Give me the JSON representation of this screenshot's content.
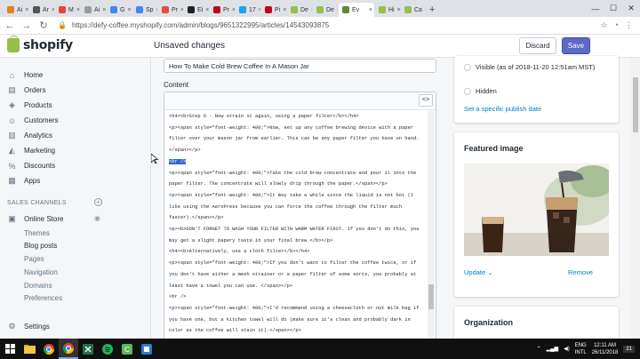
{
  "browser": {
    "tabs": [
      {
        "label": "Ai",
        "color": "#e67e22"
      },
      {
        "label": "Ar",
        "color": "#555555"
      },
      {
        "label": "M",
        "color": "#ea4335"
      },
      {
        "label": "Ai",
        "color": "#9b9b9b"
      },
      {
        "label": "G",
        "color": "#4285f4"
      },
      {
        "label": "Sp",
        "color": "#4285f4"
      },
      {
        "label": "Pr",
        "color": "#e74c3c"
      },
      {
        "label": "Ei",
        "color": "#222222"
      },
      {
        "label": "Pr",
        "color": "#bd081c"
      },
      {
        "label": "17",
        "color": "#1da1f2"
      },
      {
        "label": "Pi",
        "color": "#bd081c"
      },
      {
        "label": "De",
        "color": "#96bf48"
      },
      {
        "label": "De",
        "color": "#96bf48"
      },
      {
        "label": "Ev",
        "color": "#5b8a3c"
      },
      {
        "label": "Hi",
        "color": "#96bf48"
      },
      {
        "label": "Ca",
        "color": "#96bf48"
      }
    ],
    "active_tab_label": "Ev",
    "new_tab": "+",
    "url": "https://defy-coffee.myshopify.com/admin/blogs/9651322995/articles/14543093875",
    "nav_back": "←",
    "nav_forward": "→",
    "nav_reload": "↻"
  },
  "header": {
    "logo_text": "shopify",
    "status": "Unsaved changes",
    "discard_label": "Discard",
    "save_label": "Save"
  },
  "sidebar": {
    "items": [
      {
        "label": "Home",
        "icon": "home-icon",
        "glyph": "⌂"
      },
      {
        "label": "Orders",
        "icon": "orders-icon",
        "glyph": "▤"
      },
      {
        "label": "Products",
        "icon": "products-icon",
        "glyph": "◈"
      },
      {
        "label": "Customers",
        "icon": "customers-icon",
        "glyph": "☺"
      },
      {
        "label": "Analytics",
        "icon": "analytics-icon",
        "glyph": "▥"
      },
      {
        "label": "Marketing",
        "icon": "marketing-icon",
        "glyph": "◭"
      },
      {
        "label": "Discounts",
        "icon": "discounts-icon",
        "glyph": "%"
      },
      {
        "label": "Apps",
        "icon": "apps-icon",
        "glyph": "▦"
      }
    ],
    "sales_channels": "SALES CHANNELS",
    "online_store": "Online Store",
    "sub_items": [
      "Themes",
      "Blog posts",
      "Pages",
      "Navigation",
      "Domains",
      "Preferences"
    ],
    "current_sub": "Blog posts",
    "settings": "Settings"
  },
  "editor": {
    "title_value": "How To Make Cold Brew Coffee In A Mason Jar",
    "content_label": "Content",
    "code_button": "<>",
    "lines": [
      "<h4><b>Step 6 -  Now strain it again, using a paper filter</b></h4>",
      "<p><span style=\"font-weight: 400;\">Now, set up any coffee brewing device with a paper",
      "filter over your mason jar from earlier. This can be any paper filter you have on hand.",
      "</span></p>",
      "<br />",
      "<p><span style=\"font-weight: 400;\">Take the cold brew concentrate and pour it into the",
      "paper filter. The concentrate will slowly drip through the paper.</span></p>",
      "<p><span style=\"font-weight: 400;\">It may take a while since the liquid is not hot (I",
      "like using the AeroPress because you can force the coffee through the filter much",
      "faster).</span></p>",
      "<p><b>DON'T FORGET TO WASH YOUR FILTER WITH WARM WATER FIRST. If you don't do this, you",
      "may get a slight papery taste in your final brew.</b></p>",
      "<h4><b>Alternatively, use a cloth filter</b></h4>",
      "<p><span style=\"font-weight: 400;\">If you don't want to filter the coffee twice, or if",
      "you don't have either a mesh strainer or a paper filter of some sorts, you probably at",
      "least have a towel you can use. </span></p>",
      "<br />",
      "<p><span style=\"font-weight: 400;\">I'd recommend using a cheesecloth or nut milk bag if",
      "you have one, but a kitchen towel will do (make sure it's clean and probably dark in",
      "color as the coffee will stain it).</span></p>",
      "<br />"
    ],
    "selected_line_index": 4
  },
  "visibility": {
    "visible_label": "Visible (as of 2018-11-20 12:51am MST)",
    "hidden_label": "Hidden",
    "publish_link": "Set a specific publish date"
  },
  "featured_image": {
    "title": "Featured image",
    "update_link": "Update",
    "remove_link": "Remove"
  },
  "organization": {
    "title": "Organization"
  },
  "taskbar": {
    "lang": "ENG",
    "layout": "INTL",
    "time": "12:11 AM",
    "date": "26/11/2018",
    "notif": "21"
  }
}
